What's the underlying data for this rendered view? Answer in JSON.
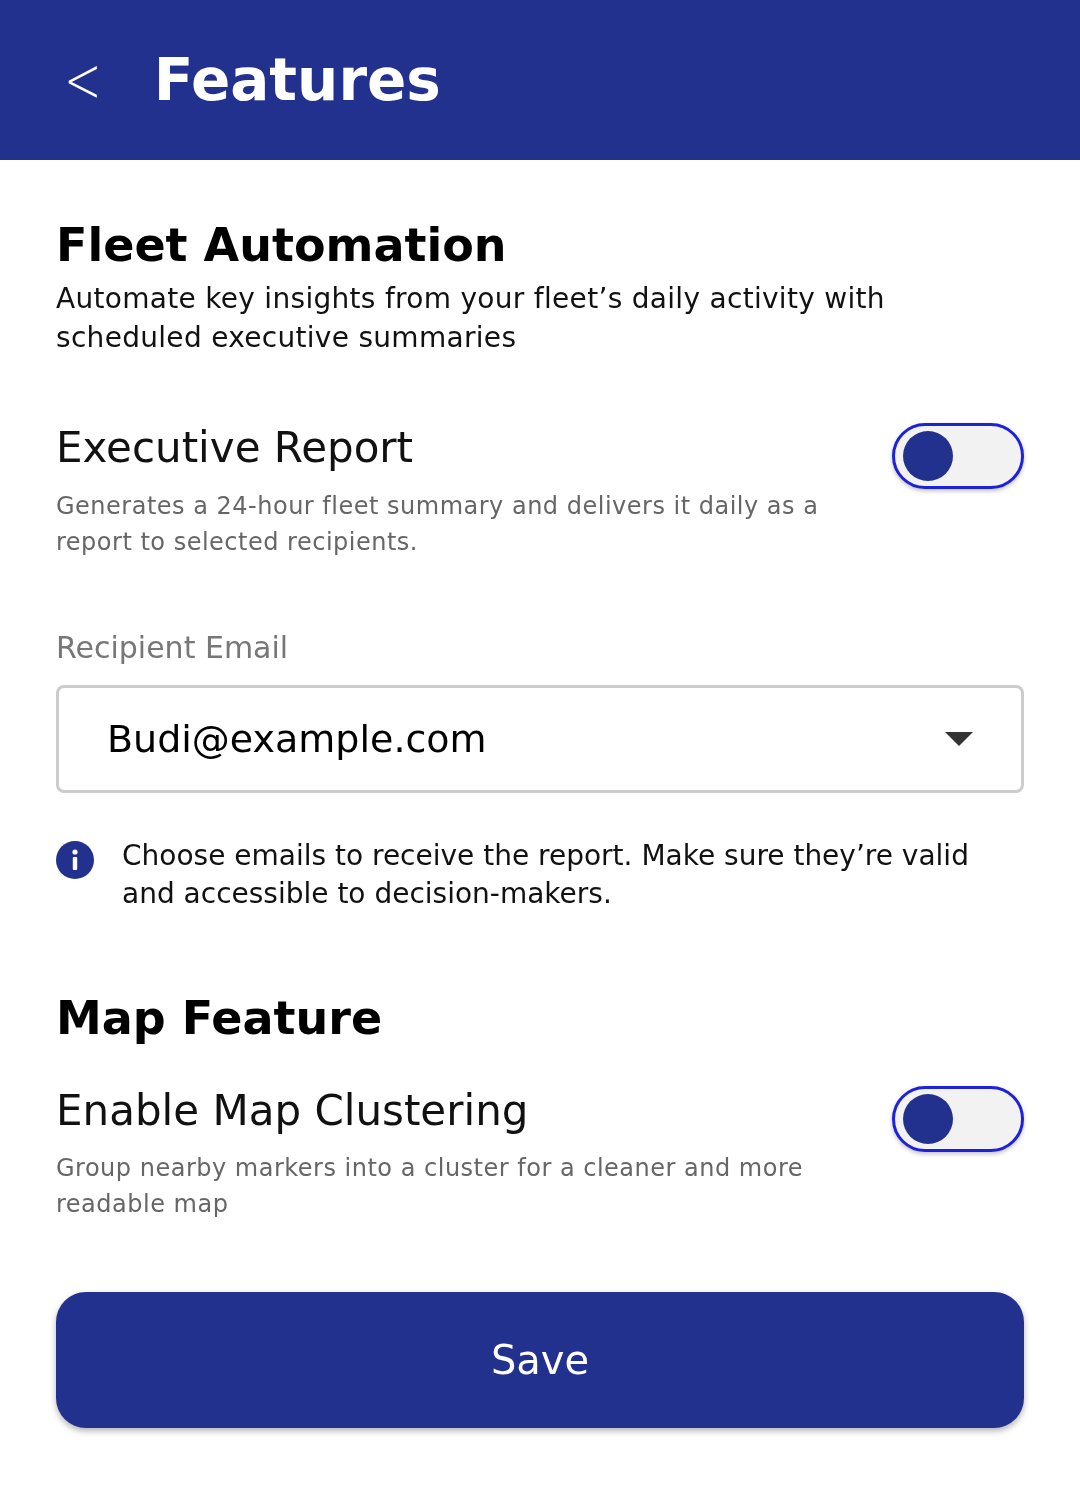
{
  "header": {
    "back": "<",
    "title": "Features"
  },
  "sections": [
    {
      "title": "Fleet Automation",
      "description": "Automate key insights from your fleet’s daily activity with scheduled executive summaries",
      "settings": [
        {
          "label": "Executive Report",
          "description": "Generates a 24-hour fleet summary and delivers it daily as a report to selected recipients.",
          "on": false
        }
      ],
      "field": {
        "label": "Recipient Email",
        "value": "Budi@example.com",
        "hint": "Choose emails to receive the report. Make sure they’re valid and accessible to decision-makers."
      }
    },
    {
      "title": "Map Feature",
      "settings": [
        {
          "label": "Enable Map Clustering",
          "description": "Group nearby markers into a cluster for a cleaner and more readable map",
          "on": false
        }
      ]
    }
  ],
  "save_button": "Save"
}
